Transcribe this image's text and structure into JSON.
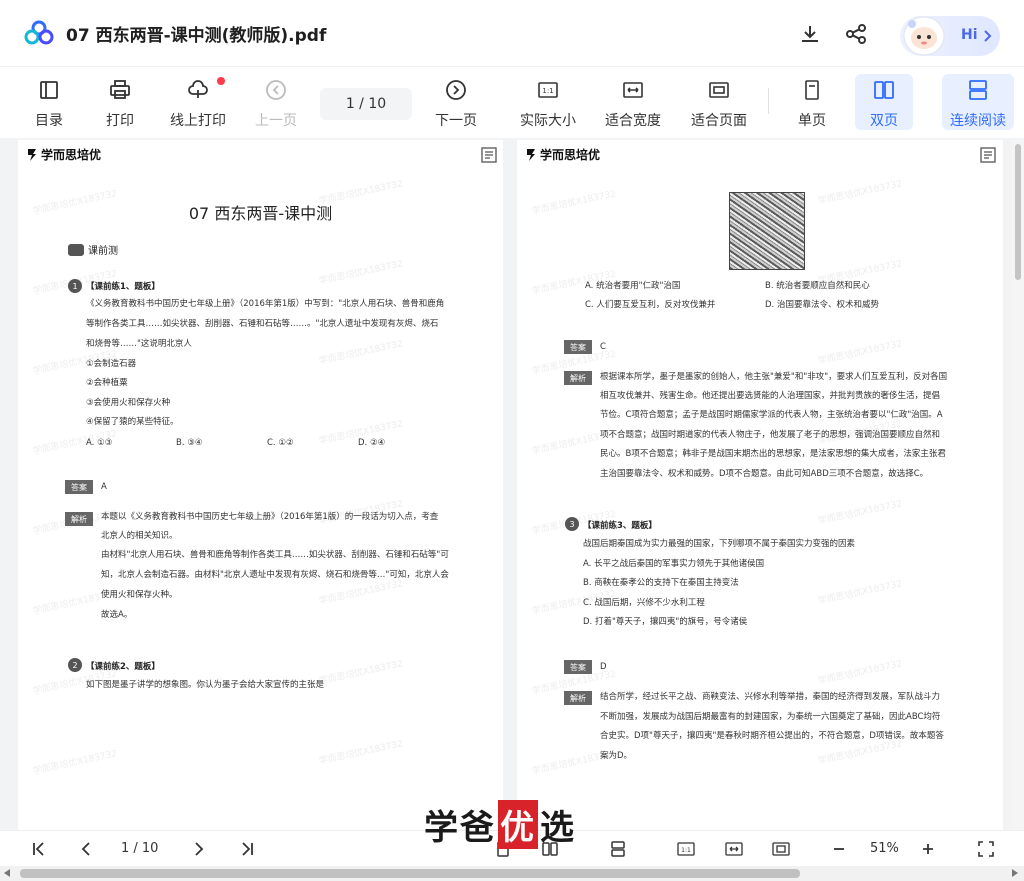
{
  "header": {
    "title": "07 西东两晋-课中测(教师版).pdf",
    "hi_label": "Hi",
    "icons": {
      "logo": "cloud-logo",
      "download": "download-icon",
      "share": "share-icon"
    }
  },
  "toolbar": {
    "items": [
      {
        "label": "目录",
        "icon": "toc-icon"
      },
      {
        "label": "打印",
        "icon": "printer-icon"
      },
      {
        "label": "线上打印",
        "icon": "cloud-print-icon"
      },
      {
        "label": "上一页",
        "icon": "prev-page-icon"
      },
      {
        "label": "下一页",
        "icon": "next-page-icon"
      },
      {
        "label": "实际大小",
        "icon": "actual-size-icon"
      },
      {
        "label": "适合宽度",
        "icon": "fit-width-icon"
      },
      {
        "label": "适合页面",
        "icon": "fit-page-icon"
      },
      {
        "label": "单页",
        "icon": "single-page-icon"
      },
      {
        "label": "双页",
        "icon": "double-page-icon"
      },
      {
        "label": "连续阅读",
        "icon": "continuous-read-icon"
      }
    ],
    "page_indicator": "1  /  10"
  },
  "left_page": {
    "brand": "学而思培优",
    "title": "07 西东两晋-课中测",
    "section": "课前测",
    "q1": {
      "num": "1",
      "header": "【课前练1、题板】",
      "lines": [
        "《义务教育教科书中国历史七年级上册》（2016年第1版）中写到：\"北京人用石块、兽骨和鹿角",
        "等制作各类工具……如尖状器、刮削器、石锤和石砧等……。\"北京人遗址中发现有灰烬、烧石",
        "和烧骨等……\"这说明北京人"
      ],
      "items": [
        "①会制造石器",
        "②会种植粟",
        "③会使用火和保存火种",
        "④保留了猿的某些特征。"
      ],
      "options": [
        "A. ①③",
        "B. ③④",
        "C. ①②",
        "D. ②④"
      ],
      "answer_tag": "答案",
      "answer": "A",
      "analysis_tag": "解析",
      "analysis": [
        "本题以《义务教育教科书中国历史七年级上册》（2016年第1版）的一段话为切入点，考查",
        "北京人的相关知识。",
        "由材料\"北京人用石块、兽骨和鹿角等制作各类工具……如尖状器、刮削器、石锤和石砧等\"可",
        "知，北京人会制造石器。由材料\"北京人遗址中发现有灰烬、烧石和烧骨等…\"可知，北京人会",
        "使用火和保存火种。",
        "故选A。"
      ]
    },
    "q2": {
      "num": "2",
      "header": "【课前练2、题板】",
      "lines": [
        "如下图是墨子讲学的想象图。你认为墨子会给大家宣传的主张是"
      ]
    }
  },
  "right_page": {
    "brand": "学而思培优",
    "q2_options": [
      "A. 统治者要用\"仁政\"治国",
      "B. 统治者要顺应自然和民心",
      "C. 人们要互爱互利，反对攻伐兼并",
      "D. 治国要靠法令、权术和威势"
    ],
    "q2_answer_tag": "答案",
    "q2_answer": "C",
    "q2_analysis_tag": "解析",
    "q2_analysis": [
      "根据课本所学，墨子是墨家的创始人，他主张\"兼爱\"和\"非攻\"，要求人们互爱互利，反对各国",
      "相互攻伐兼并、残害生命。他还提出要选贤能的人治理国家，并批判贵族的奢侈生活，提倡",
      "节俭。C项符合题意；孟子是战国时期儒家学派的代表人物，主张统治者要以\"仁政\"治国。A",
      "项不合题意；战国时期道家的代表人物庄子，他发展了老子的思想，强调治国要顺应自然和",
      "民心。B项不合题意；韩非子是战国末期杰出的思想家，是法家思想的集大成者，法家主张君",
      "主治国要靠法令、权术和威势。D项不合题意。由此可知ABD三项不合题意，故选择C。"
    ],
    "q3": {
      "num": "3",
      "header": "【课前练3、题板】",
      "stem": "战国后期秦国成为实力最强的国家，下列哪项不属于秦国实力变强的因素",
      "options": [
        "A. 长平之战后秦国的军事实力领先于其他诸侯国",
        "B. 商鞅在秦孝公的支持下在秦国主持变法",
        "C. 战国后期，兴修不少水利工程",
        "D. 打着\"尊天子，攘四夷\"的旗号，号令诸侯"
      ],
      "answer_tag": "答案",
      "answer": "D",
      "analysis_tag": "解析",
      "analysis": [
        "结合所学，经过长平之战、商鞅变法、兴修水利等举措，秦国的经济得到发展，军队战斗力",
        "不断加强，发展成为战国后期最富有的封建国家，为秦统一六国奠定了基础，因此ABC均符",
        "合史实。D项\"尊天子，攘四夷\"是春秋时期齐桓公提出的，不符合题意，D项错误。故本题答",
        "案为D。"
      ]
    }
  },
  "watermark_text": "学而思培优X183732",
  "bottombar": {
    "page_indicator": "1  /  10",
    "zoom": "51%",
    "icons": [
      "first-page-icon",
      "prev-icon",
      "next-icon",
      "last-page-icon",
      "single-page-icon",
      "double-page-icon",
      "continuous-icon",
      "actual-size-icon",
      "fit-width-icon",
      "fit-page-icon",
      "zoom-out-icon",
      "zoom-in-icon",
      "fullscreen-icon"
    ]
  },
  "overlay": {
    "part1": "学爸",
    "part2": "优",
    "part3": "选"
  }
}
